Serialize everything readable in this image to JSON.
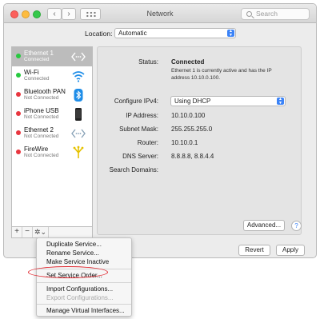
{
  "window": {
    "title": "Network"
  },
  "search": {
    "placeholder": "Search"
  },
  "location": {
    "label": "Location:",
    "value": "Automatic"
  },
  "services": [
    {
      "name": "Ethernet 1",
      "status": "Connected",
      "dot_color": "#27c93f",
      "icon": "ethernet-icon",
      "selected": true
    },
    {
      "name": "Wi-Fi",
      "status": "Connected",
      "dot_color": "#27c93f",
      "icon": "wifi-icon"
    },
    {
      "name": "Bluetooth PAN",
      "status": "Not Connected",
      "dot_color": "#e8363f",
      "icon": "bluetooth-icon"
    },
    {
      "name": "iPhone USB",
      "status": "Not Connected",
      "dot_color": "#e8363f",
      "icon": "iphone-icon"
    },
    {
      "name": "Ethernet 2",
      "status": "Not Connected",
      "dot_color": "#e8363f",
      "icon": "ethernet-icon"
    },
    {
      "name": "FireWire",
      "status": "Not Connected",
      "dot_color": "#e8363f",
      "icon": "firewire-icon"
    }
  ],
  "tools": {
    "add": "+",
    "remove": "−",
    "gear": "✲⌄"
  },
  "details": {
    "status_label": "Status:",
    "status_value": "Connected",
    "status_note": "Ethernet 1 is currently active and has the IP address 10.10.0.100.",
    "configure_label": "Configure IPv4:",
    "configure_value": "Using DHCP",
    "ip_label": "IP Address:",
    "ip_value": "10.10.0.100",
    "subnet_label": "Subnet Mask:",
    "subnet_value": "255.255.255.0",
    "router_label": "Router:",
    "router_value": "10.10.0.1",
    "dns_label": "DNS Server:",
    "dns_value": "8.8.8.8, 8.8.4.4",
    "search_domains_label": "Search Domains:"
  },
  "buttons": {
    "advanced": "Advanced...",
    "help": "?",
    "revert": "Revert",
    "apply": "Apply"
  },
  "menu": {
    "items": [
      {
        "label": "Duplicate Service...",
        "enabled": true
      },
      {
        "label": "Rename Service...",
        "enabled": true
      },
      {
        "label": "Make Service Inactive",
        "enabled": true
      },
      {
        "label": "Set Service Order...",
        "enabled": true,
        "highlighted": true
      },
      {
        "label": "Import Configurations...",
        "enabled": true
      },
      {
        "label": "Export Configurations...",
        "enabled": false
      },
      {
        "label": "Manage Virtual Interfaces...",
        "enabled": true
      }
    ]
  },
  "colors": {
    "accent": "#3b83f7",
    "highlight": "#e0262e",
    "connected": "#27c93f",
    "not_connected": "#e8363f"
  }
}
